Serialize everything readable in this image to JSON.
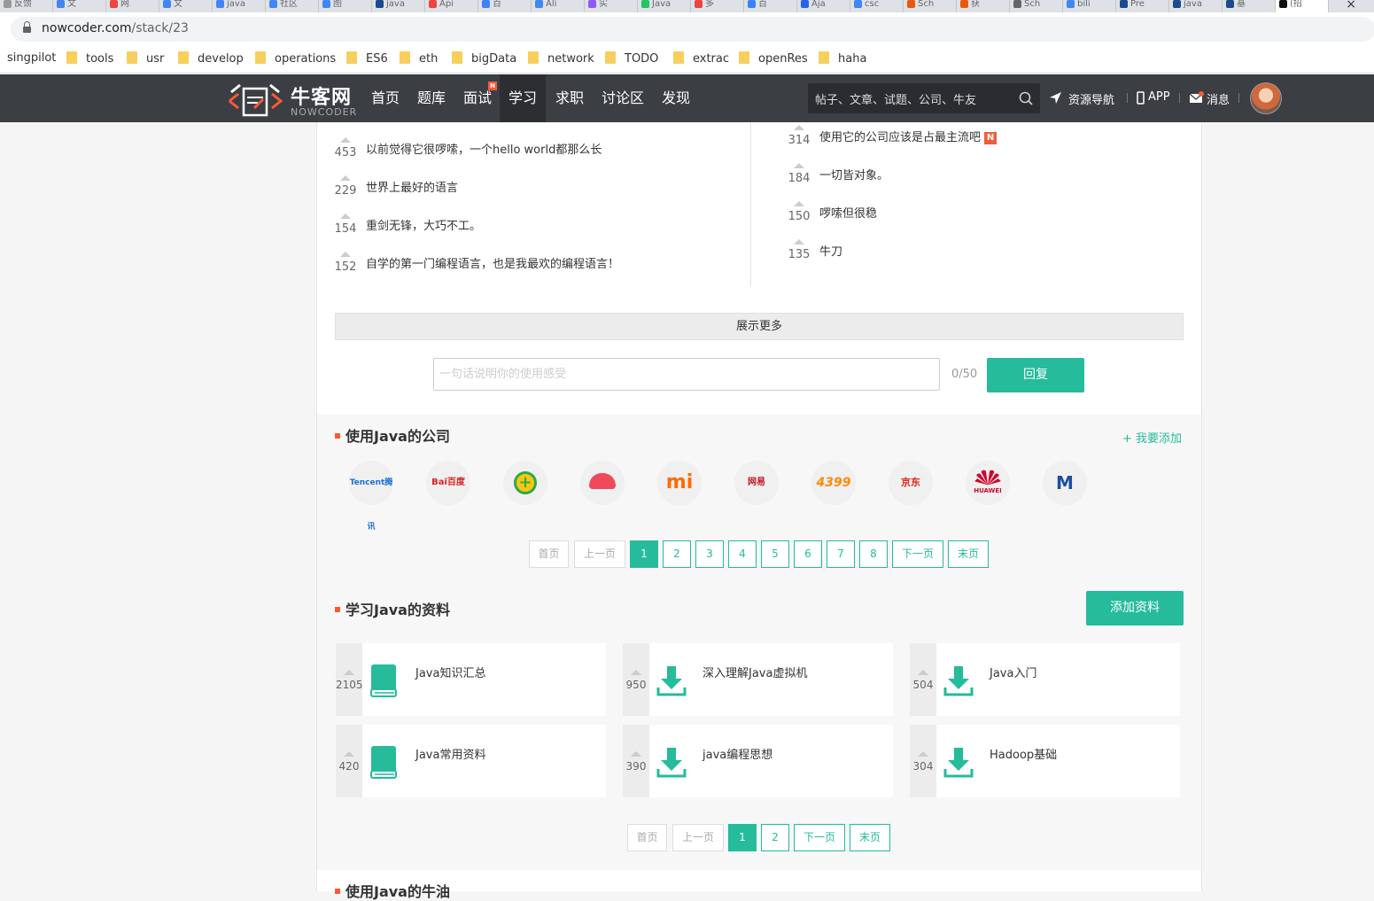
{
  "browser": {
    "url_host": "nowcoder.com",
    "url_path": "/stack/23",
    "tabs": [
      "反馈",
      "文",
      "网",
      "文",
      "java",
      "社区",
      "图",
      "java",
      "Api",
      "百",
      "Ali",
      "实",
      "Java",
      "多",
      "百",
      "Aja",
      "csc",
      "Sch",
      "获",
      "Sch",
      "bili",
      "Pre",
      "java",
      "基",
      "(招"
    ],
    "bookmarks": [
      "singpilot",
      "tools",
      "usr",
      "develop",
      "operations",
      "ES6",
      "eth",
      "bigData",
      "network",
      "TODO",
      "extrac",
      "openRes",
      "haha"
    ]
  },
  "site": {
    "logo_text": "牛客网",
    "logo_sub": "NOWCODER",
    "nav": [
      "首页",
      "题库",
      "面试",
      "学习",
      "求职",
      "讨论区",
      "发现"
    ],
    "nav_badge": "N",
    "search_placeholder": "帖子、文章、试题、公司、牛友",
    "resource_nav": "资源导航",
    "app": "APP",
    "messages": "消息"
  },
  "comments_left": [
    {
      "votes": "453",
      "text": "以前觉得它很啰嗦，一个hello world都那么长"
    },
    {
      "votes": "229",
      "text": "世界上最好的语言"
    },
    {
      "votes": "154",
      "text": "重剑无锋，大巧不工。"
    },
    {
      "votes": "152",
      "text": "自学的第一门编程语言，也是我最欢的编程语言！"
    }
  ],
  "comments_right": [
    {
      "votes": "314",
      "text": "使用它的公司应该是占最主流吧",
      "badge": "N"
    },
    {
      "votes": "184",
      "text": "一切皆对象。"
    },
    {
      "votes": "150",
      "text": "啰嗦但很稳"
    },
    {
      "votes": "135",
      "text": "牛刀"
    }
  ],
  "show_more": "展示更多",
  "reply": {
    "placeholder": "一句话说明你的使用感受",
    "counter": "0/50",
    "button": "回复"
  },
  "companies_section": {
    "title": "使用Java的公司",
    "add_link": "+ 我要添加",
    "logos": [
      "Tencent腾讯",
      "Bai百度",
      "+",
      "",
      "mi",
      "网易",
      "4399",
      "京东",
      "HUAWEI",
      "M"
    ],
    "pager": [
      "首页",
      "上一页",
      "1",
      "2",
      "3",
      "4",
      "5",
      "6",
      "7",
      "8",
      "下一页",
      "末页"
    ]
  },
  "materials_section": {
    "title": "学习Java的资料",
    "add_button": "添加资料",
    "cards": [
      {
        "votes": "2105",
        "title": "Java知识汇总",
        "icon": "book-icon"
      },
      {
        "votes": "950",
        "title": "深入理解Java虚拟机",
        "icon": "download-icon"
      },
      {
        "votes": "504",
        "title": "Java入门",
        "icon": "download-icon"
      },
      {
        "votes": "420",
        "title": "Java常用资料",
        "icon": "book-icon"
      },
      {
        "votes": "390",
        "title": "java编程思想",
        "icon": "download-icon"
      },
      {
        "votes": "304",
        "title": "Hadoop基础",
        "icon": "download-icon"
      }
    ],
    "pager": [
      "首页",
      "上一页",
      "1",
      "2",
      "下一页",
      "末页"
    ]
  },
  "next_section_title": "使用Java的牛油",
  "colors": {
    "accent": "#25bb9b",
    "nav_bg": "#3b3e43",
    "badge": "#f55b3a"
  }
}
